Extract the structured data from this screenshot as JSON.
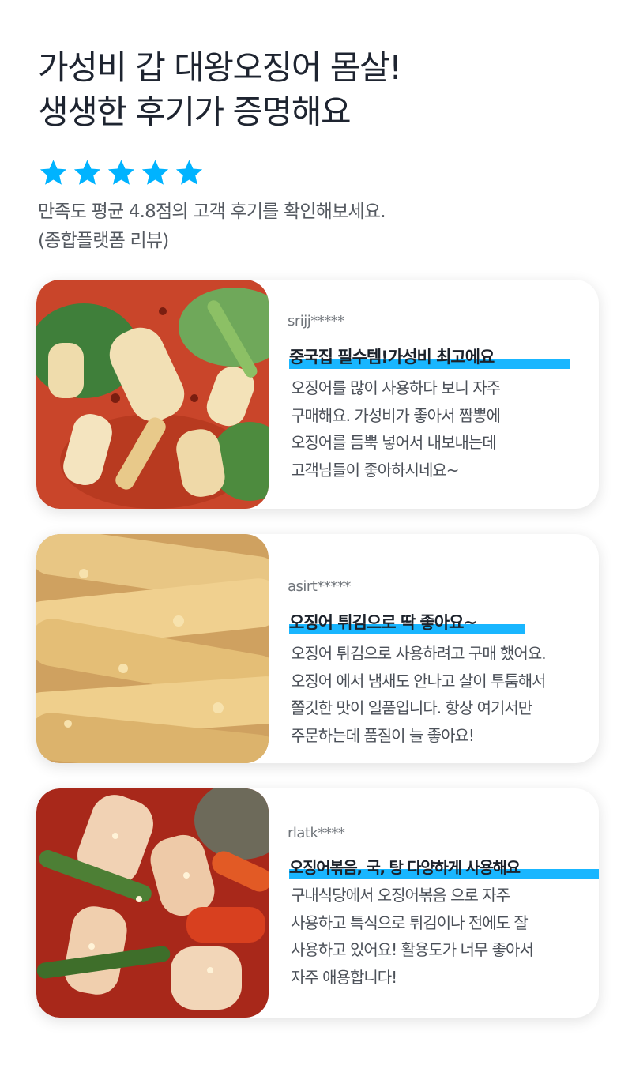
{
  "headline": {
    "line1": "가성비 갑 대왕오징어 몸살!",
    "line2": "생생한 후기가 증명해요"
  },
  "rating": {
    "stars": 5,
    "star_color": "#00b3ff",
    "line1": "만족도 평균 4.8점의 고객 후기를 확인해보세요.",
    "line2": "(종합플랫폼 리뷰)"
  },
  "accent_color": "#19b6ff",
  "reviews": [
    {
      "photo_icon": "spicy-stir-fried-squid-photo",
      "user": "srijj*****",
      "title": "중국집 필수템!가성비 최고에요",
      "lines": [
        "오징어를 많이 사용하다 보니 자주",
        "구매해요. 가성비가 좋아서 짬뽕에",
        "오징어를 듬뿍 넣어서 내보내는데",
        "고객님들이 좋아하시네요~"
      ]
    },
    {
      "photo_icon": "fried-squid-photo",
      "user": "asirt*****",
      "title": "오징어 튀김으로 딱 좋아요~",
      "lines": [
        "오징어 튀김으로 사용하려고 구매 했어요.",
        "오징어 에서 냄새도 안나고 살이 투툼해서",
        "쫄깃한 맛이 일품입니다. 항상 여기서만",
        "주문하는데 품질이 늘 좋아요!"
      ]
    },
    {
      "photo_icon": "squid-bokkeum-photo",
      "user": "rlatk****",
      "title": "오징어볶음, 국, 탕 다양하게 사용해요",
      "lines": [
        "구내식당에서 오징어볶음 으로 자주",
        "사용하고 특식으로 튀김이나 전에도 잘",
        "사용하고 있어요! 활용도가 너무 좋아서",
        "자주 애용합니다!"
      ]
    }
  ]
}
